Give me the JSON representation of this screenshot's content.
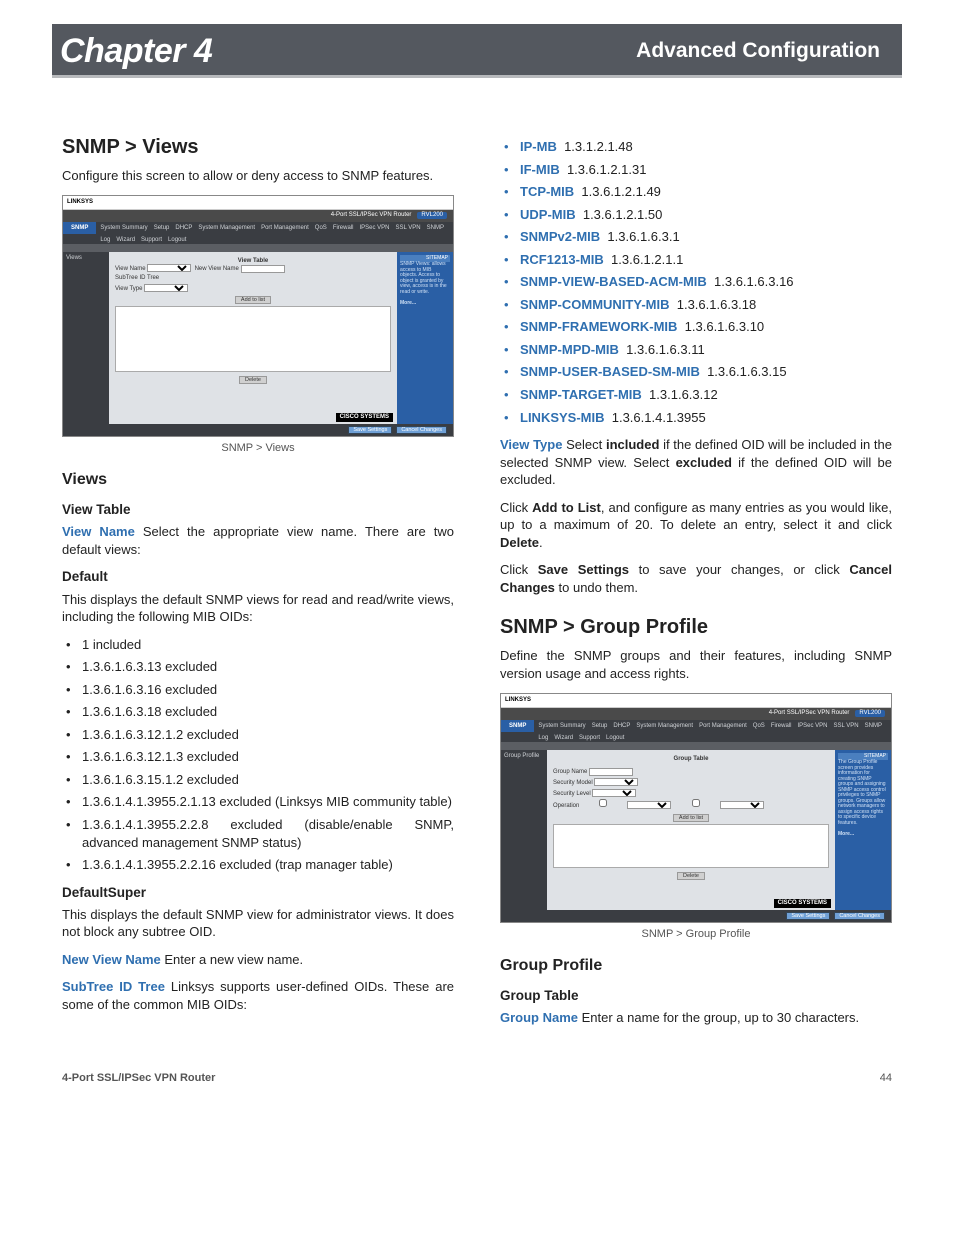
{
  "header": {
    "chapter": "Chapter 4",
    "section": "Advanced Configuration"
  },
  "left": {
    "h_snmp_views": "SNMP > Views",
    "intro": "Configure this screen to allow or deny access to SNMP features.",
    "fig1_caption": "SNMP > Views",
    "h_views": "Views",
    "h_view_table": "View Table",
    "view_name_term": "View Name",
    "view_name_text": "  Select the appropriate view name. There are two default views:",
    "h_default": "Default",
    "default_text": "This displays the default SNMP views for read and read/write views, including the following MIB OIDs:",
    "default_oids": [
      "1 included",
      "1.3.6.1.6.3.13 excluded",
      "1.3.6.1.6.3.16 excluded",
      "1.3.6.1.6.3.18 excluded",
      "1.3.6.1.6.3.12.1.2 excluded",
      "1.3.6.1.6.3.12.1.3 excluded",
      "1.3.6.1.6.3.15.1.2 excluded",
      "1.3.6.1.4.1.3955.2.1.13 excluded (Linksys MIB community table)",
      "1.3.6.1.4.1.3955.2.2.8 excluded (disable/enable SNMP, advanced management SNMP status)",
      "1.3.6.1.4.1.3955.2.2.16 excluded (trap manager table)"
    ],
    "h_defaultsuper": "DefaultSuper",
    "defaultsuper_text": "This displays the default SNMP view for administrator views. It does not block any subtree OID.",
    "new_view_name_term": "New View Name",
    "new_view_name_text": "  Enter a new view name.",
    "subtree_term": "SubTree ID Tree",
    "subtree_text": " Linksys supports user-defined OIDs. These are some of the common MIB OIDs:"
  },
  "right": {
    "mibs": [
      {
        "name": "IP-MB",
        "oid": "1.3.1.2.1.48"
      },
      {
        "name": "IF-MIB",
        "oid": "1.3.6.1.2.1.31"
      },
      {
        "name": "TCP-MIB",
        "oid": "1.3.6.1.2.1.49"
      },
      {
        "name": "UDP-MIB",
        "oid": "1.3.6.1.2.1.50"
      },
      {
        "name": "SNMPv2-MIB",
        "oid": "1.3.6.1.6.3.1"
      },
      {
        "name": "RCF1213-MIB",
        "oid": "1.3.6.1.2.1.1"
      },
      {
        "name": "SNMP-VIEW-BASED-ACM-MIB",
        "oid": "1.3.6.1.6.3.16"
      },
      {
        "name": "SNMP-COMMUNITY-MIB",
        "oid": "1.3.6.1.6.3.18"
      },
      {
        "name": "SNMP-FRAMEWORK-MIB",
        "oid": "1.3.6.1.6.3.10"
      },
      {
        "name": "SNMP-MPD-MIB",
        "oid": "1.3.6.1.6.3.11"
      },
      {
        "name": "SNMP-USER-BASED-SM-MIB",
        "oid": "1.3.6.1.6.3.15"
      },
      {
        "name": "SNMP-TARGET-MIB",
        "oid": "1.3.1.6.3.12"
      },
      {
        "name": "LINKSYS-MIB",
        "oid": "1.3.6.1.4.1.3955"
      }
    ],
    "view_type_term": "View Type",
    "view_type_text_a": " Select ",
    "view_type_included": "included",
    "view_type_text_b": " if the defined OID will be included in the selected SNMP view. Select ",
    "view_type_excluded": "excluded",
    "view_type_text_c": " if the defined OID will be excluded.",
    "add_to_list_a": "Click ",
    "add_to_list_b": "Add to List",
    "add_to_list_c": ", and configure as many entries as you would like, up to a maximum of 20. To delete an entry, select it and click ",
    "add_to_list_d": "Delete",
    "add_to_list_e": ".",
    "save_a": "Click ",
    "save_b": "Save Settings",
    "save_c": " to save your changes, or click ",
    "save_d": "Cancel Changes",
    "save_e": " to undo them.",
    "h_snmp_group": "SNMP > Group Profile",
    "group_intro": "Define the SNMP groups and their features, including SNMP version usage and access rights.",
    "fig2_caption": "SNMP > Group Profile",
    "h_group_profile": "Group Profile",
    "h_group_table": "Group Table",
    "group_name_term": "Group Name",
    "group_name_text": " Enter a name for the group, up to 30 characters."
  },
  "shot": {
    "brand": "LINKSYS",
    "title_bar": "4-Port SSL/IPSec VPN Router",
    "model": "RVL200",
    "tab": "SNMP",
    "menu": [
      "System Summary",
      "Setup",
      "DHCP",
      "System Management",
      "Port Management",
      "QoS",
      "Firewall",
      "IPSec VPN",
      "SSL VPN",
      "SNMP",
      "Log",
      "Wizard",
      "Support",
      "Logout"
    ],
    "sitemap": "SITEMAP",
    "views_side": "Views",
    "group_side": "Group Profile",
    "view_table_title": "View Table",
    "group_table_title": "Group Table",
    "labels": {
      "view_name": "View Name",
      "subtree": "SubTree ID Tree",
      "view_type": "View Type",
      "new_view": "New View Name",
      "group_name": "Group Name",
      "sec_model": "Security Model",
      "sec_level": "Security Level",
      "operation": "Operation"
    },
    "buttons": {
      "add": "Add to list",
      "delete": "Delete",
      "save": "Save Settings",
      "cancel": "Cancel Changes"
    },
    "cisco": "CISCO SYSTEMS"
  },
  "footer": {
    "left": "4-Port SSL/IPSec VPN Router",
    "right": "44"
  }
}
